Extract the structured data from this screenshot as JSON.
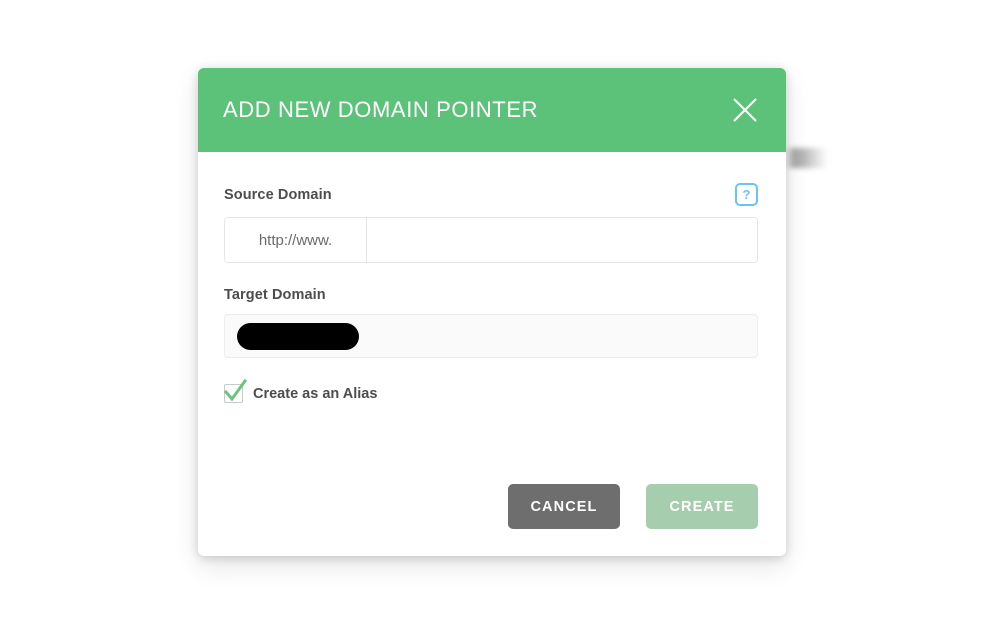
{
  "modal": {
    "title": "ADD NEW DOMAIN POINTER",
    "close_icon": "close-icon",
    "accent_color": "#5cc179",
    "fields": {
      "source_domain": {
        "label": "Source Domain",
        "help_label": "?",
        "prefix": "http://www.",
        "value": "",
        "placeholder": ""
      },
      "target_domain": {
        "label": "Target Domain",
        "value": "",
        "redacted": true
      }
    },
    "checkbox": {
      "label": "Create as an Alias",
      "checked": true,
      "check_color": "#6ec37e"
    },
    "buttons": {
      "cancel": "CANCEL",
      "create": "CREATE",
      "cancel_color": "#6e6e6e",
      "create_color": "#a6cdad"
    }
  }
}
